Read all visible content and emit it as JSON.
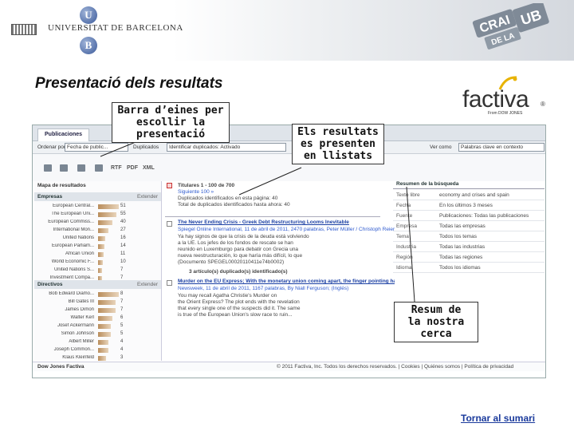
{
  "banner": {
    "university_name": "UNIVERSITAT DE BARCELONA",
    "emblem_letters": [
      "U",
      "B"
    ],
    "crai_logo_text": "CRAI DE LA UB"
  },
  "slide_title": "Presentació dels resultats",
  "factiva_logo": {
    "word": "factiva",
    "registered": "®",
    "sub": "From DOW JONES"
  },
  "screen": {
    "tab": "Publicaciones",
    "options": [
      {
        "label": "Ordenar por",
        "value": "Fecha de public..."
      },
      {
        "label": "Duplicados",
        "value": "Identificar duplicados: Activado"
      },
      {
        "label": "Ver como",
        "value": "Palabras clave en contexto"
      }
    ],
    "tools": [
      "RTF",
      "PDF",
      "XML"
    ],
    "left_panel": {
      "heading": "Mapa de resultados",
      "companies": {
        "title": "Empresas",
        "action": "Extender",
        "rows": [
          {
            "name": "European Central...",
            "count": "51",
            "fill": 1.0
          },
          {
            "name": "The European Uni...",
            "count": "55",
            "fill": 0.9
          },
          {
            "name": "European Commiss...",
            "count": "40",
            "fill": 0.7
          },
          {
            "name": "International Mon...",
            "count": "27",
            "fill": 0.5
          },
          {
            "name": "United Nations",
            "count": "16",
            "fill": 0.35
          },
          {
            "name": "European Parliam...",
            "count": "14",
            "fill": 0.3
          },
          {
            "name": "African Union",
            "count": "11",
            "fill": 0.25
          },
          {
            "name": "World Economic F...",
            "count": "10",
            "fill": 0.22
          },
          {
            "name": "United Nations S...",
            "count": "7",
            "fill": 0.18
          },
          {
            "name": "Investment Compa...",
            "count": "7",
            "fill": 0.18
          }
        ]
      },
      "people": {
        "title": "Directivos",
        "action": "Extender",
        "rows": [
          {
            "name": "Bob Edward Diamo...",
            "count": "8",
            "fill": 1.0
          },
          {
            "name": "Bill Gates III",
            "count": "7",
            "fill": 0.85
          },
          {
            "name": "James Dimon",
            "count": "7",
            "fill": 0.85
          },
          {
            "name": "Walter Kerl",
            "count": "6",
            "fill": 0.7
          },
          {
            "name": "Josef Ackermann",
            "count": "5",
            "fill": 0.6
          },
          {
            "name": "Simon Johnson",
            "count": "5",
            "fill": 0.6
          },
          {
            "name": "Albert Miller",
            "count": "4",
            "fill": 0.5
          },
          {
            "name": "Joseph Common...",
            "count": "4",
            "fill": 0.5
          },
          {
            "name": "Klaus Kleinfeld",
            "count": "3",
            "fill": 0.4
          }
        ]
      }
    },
    "results": {
      "summary_lines": [
        "Titulares 1 - 100 de 700",
        "Siguiente 100 »",
        "Duplicados identificados en esta página: 40",
        "Total de duplicados identificados hasta ahora: 40"
      ],
      "items": [
        {
          "title": "The Never Ending Crisis - Greek Debt Restructuring Looms Inevitable",
          "source": "Spiegel Online International, 11 de abril de 2011, 2470 palabras, Peter Müller / Christoph Reiermann / Christoph Pauly (Inglés)",
          "snippet": [
            "Ya hay signos de que la crisis de la deuda está volviendo",
            "a la UE. Los jefes de los fondos de rescate se han",
            "reunido en Luxemburgo para debatir con Grecia una",
            "nueva reestructuración, lo que haría más difícil, lo que",
            "(Documento SPEGEL00020110411e74b0002)"
          ],
          "dupes": "3 artículo(s) duplicado(s) identificado(s)"
        },
        {
          "title": "Murder on the EU Express; With the monetary union coming apart, the finger pointing has begun. Who really killed Europe?",
          "source": "Newsweek, 11 de abril de 2011, 1167 palabras, By Niall Ferguson; (Inglés)",
          "snippet": [
            "You may recall Agatha Christie's Murder on",
            "the Orient Express? The plot ends with the revelation",
            "that every single one of the suspects did it. The same",
            "is true of the European Union's slow race to ruin..."
          ]
        }
      ]
    },
    "summary": {
      "title": "Resumen de la búsqueda",
      "rows": [
        {
          "key": "Texto libre",
          "value": "economy and crises and spain"
        },
        {
          "key": "Fecha",
          "value": "En los últimos 3 meses"
        },
        {
          "key": "Fuente",
          "value": "Publicaciones: Todas las publicaciones"
        },
        {
          "key": "Empresa",
          "value": "Todas las empresas"
        },
        {
          "key": "Tema",
          "value": "Todos los temas"
        },
        {
          "key": "Industria",
          "value": "Todas las industrias"
        },
        {
          "key": "Región",
          "value": "Todas las regiones"
        },
        {
          "key": "Idioma",
          "value": "Todos los idiomas"
        }
      ]
    },
    "footer": {
      "left": "Dow Jones Factiva",
      "right": "© 2011 Factiva, Inc. Todos los derechos reservados. | Cookies | Quiénes somos | Política de privacidad"
    }
  },
  "callouts": {
    "toolbar": [
      "Barra d’eines per",
      "escollir la",
      "presentació"
    ],
    "list": [
      "Els resultats",
      "es presenten",
      "en llistats"
    ],
    "summary": [
      "Resum de",
      "la nostra",
      "cerca"
    ]
  },
  "back_link": "Tornar al sumari",
  "colors": {
    "title_text": "#111111",
    "link_blue": "#1a3a9c",
    "bar_brown": "#b98d5c",
    "accent_orange": "#e8b300"
  }
}
